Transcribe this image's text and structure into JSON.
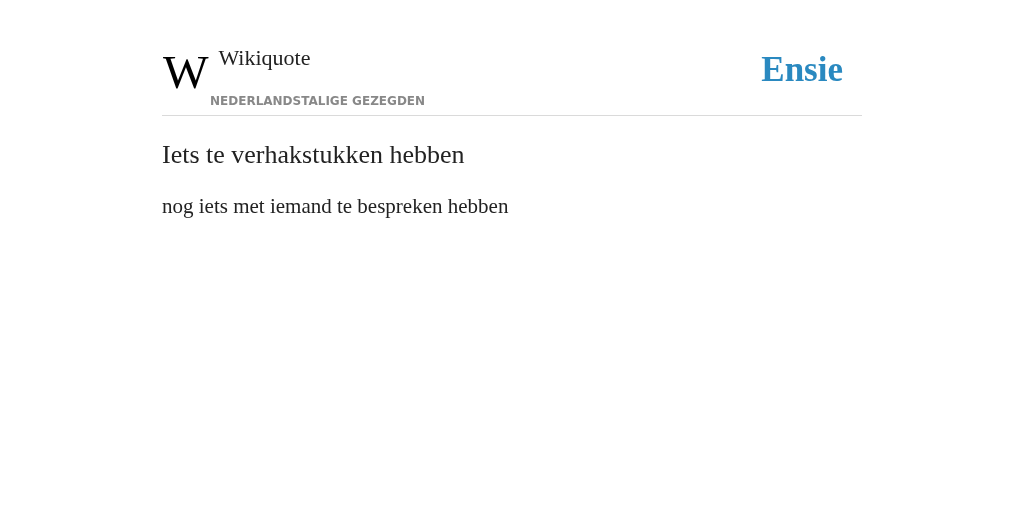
{
  "header": {
    "logo_mark": "W",
    "site_name": "Wikiquote",
    "subtitle": "NEDERLANDSTALIGE GEZEGDEN",
    "brand": "Ensie"
  },
  "article": {
    "title": "Iets te verhakstukken hebben",
    "definition": "nog iets met iemand te bespreken hebben"
  }
}
